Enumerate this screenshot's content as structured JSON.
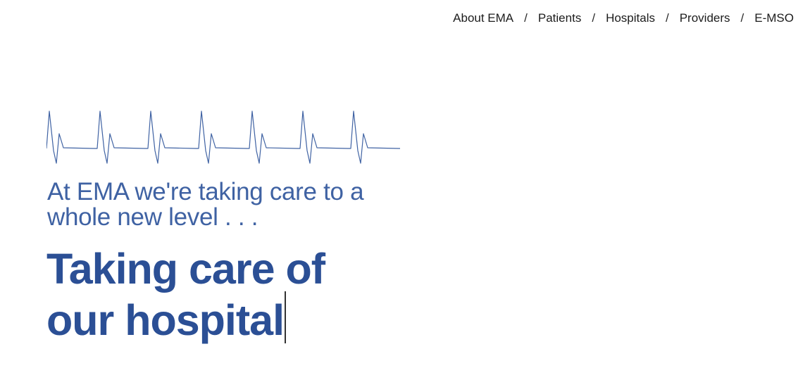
{
  "nav": {
    "items": [
      {
        "label": "About EMA"
      },
      {
        "label": "Patients"
      },
      {
        "label": "Hospitals"
      },
      {
        "label": "Providers"
      },
      {
        "label": "E-MSO"
      }
    ],
    "separator": "/"
  },
  "hero": {
    "tagline_line1": "At EMA we're taking care to a",
    "tagline_line2": "whole new level . . .",
    "headline_line1": "Taking care of",
    "headline_line2": "our hospital"
  },
  "colors": {
    "tagline": "#3f62a3",
    "headline": "#2b4f95",
    "ecg_line": "#3f62a3",
    "nav_text": "#1c1c1c"
  }
}
